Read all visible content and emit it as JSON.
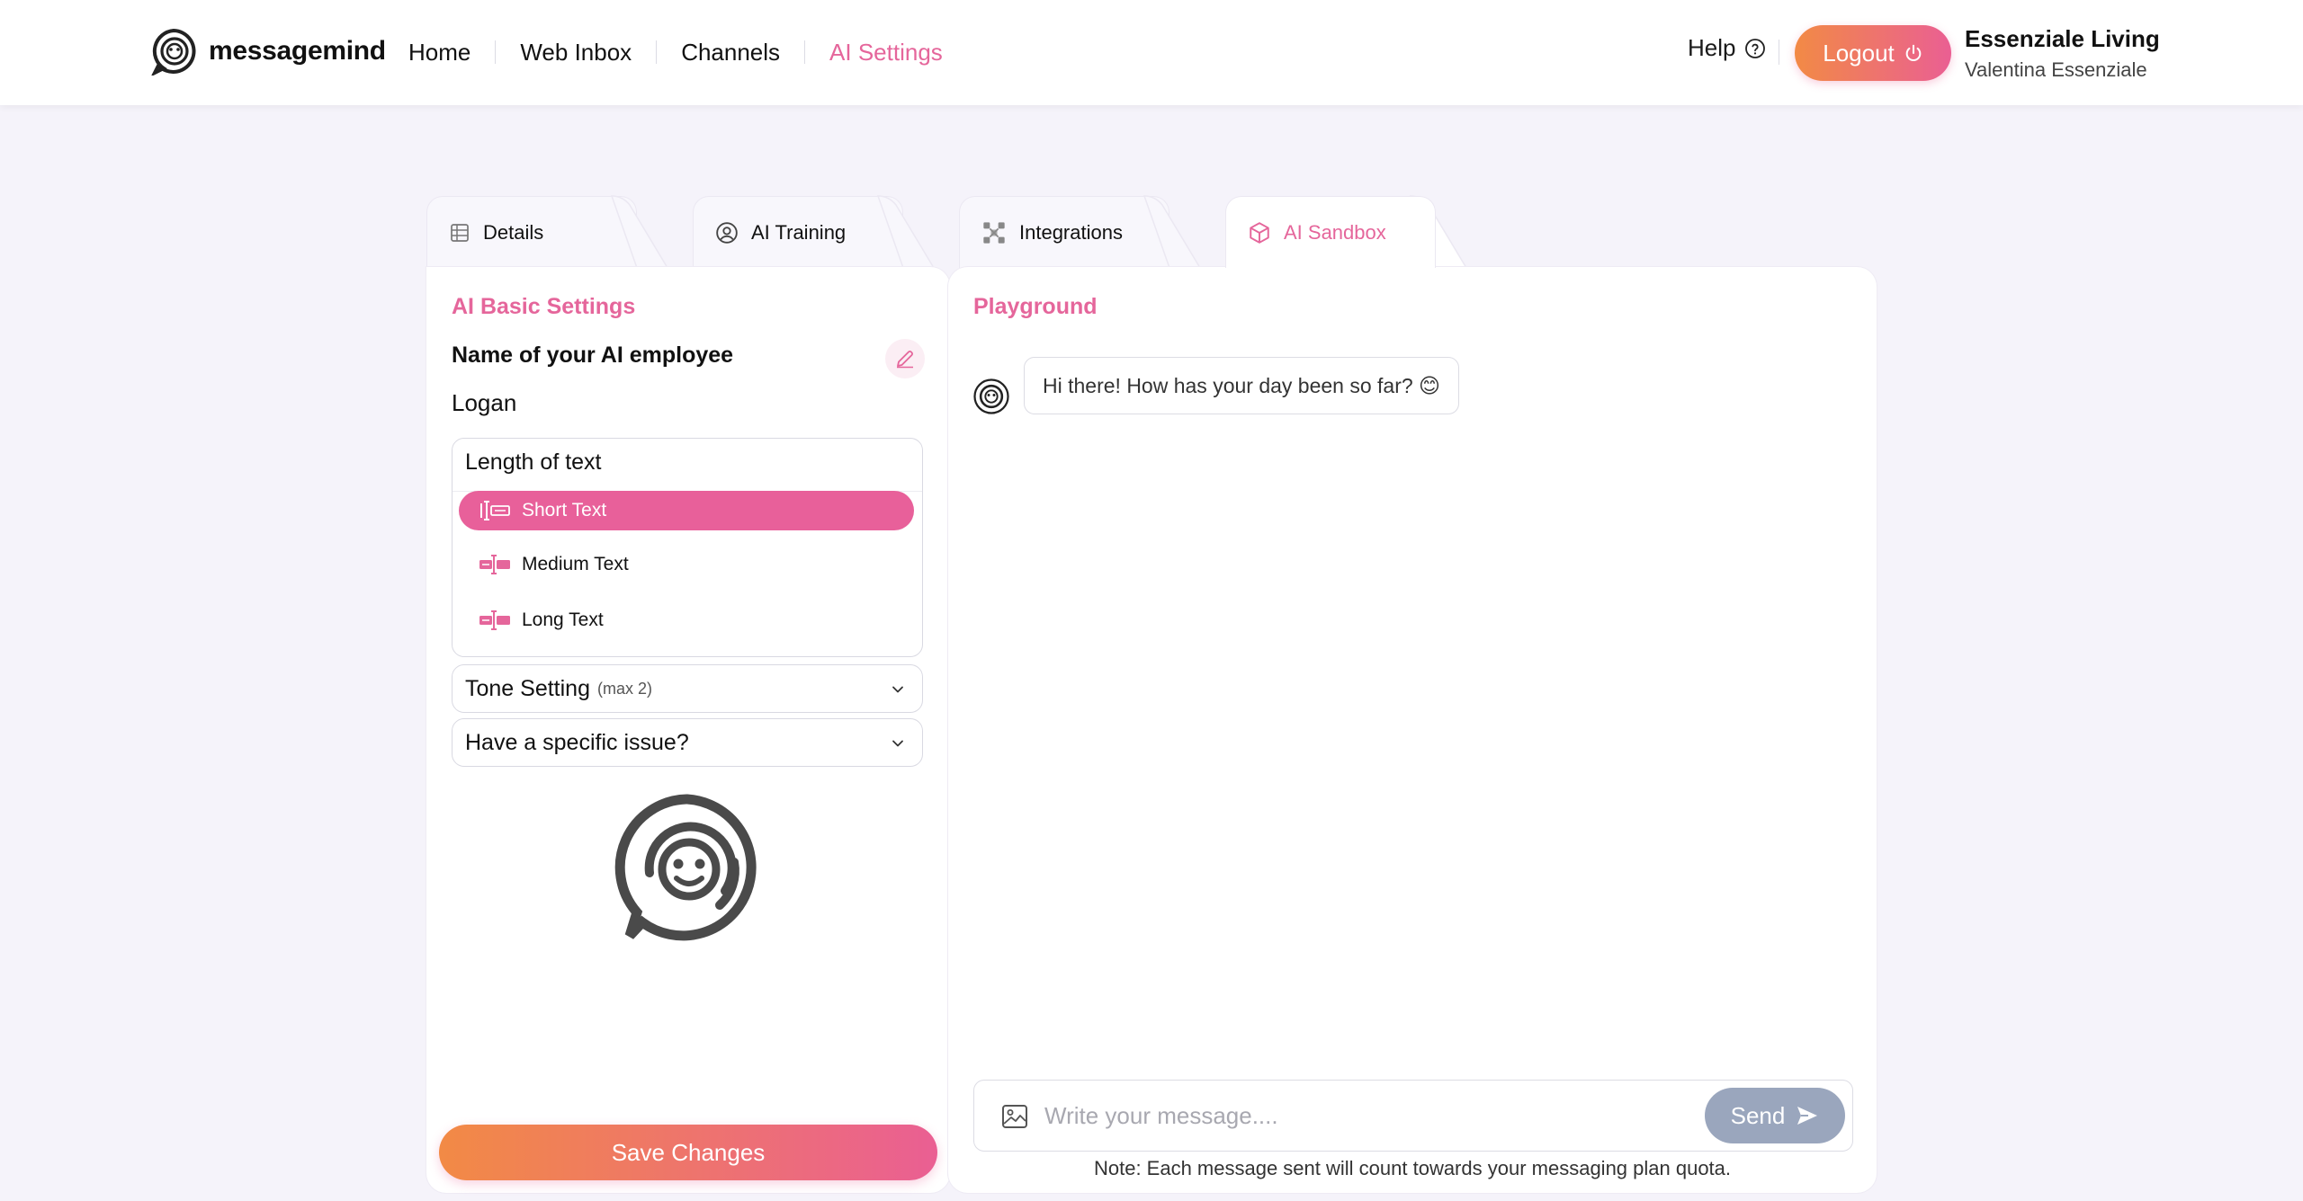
{
  "header": {
    "brand": "messagemind",
    "nav": [
      {
        "label": "Home",
        "active": false
      },
      {
        "label": "Web Inbox",
        "active": false
      },
      {
        "label": "Channels",
        "active": false
      },
      {
        "label": "AI Settings",
        "active": true
      }
    ],
    "help_label": "Help",
    "logout_label": "Logout",
    "company": "Essenziale Living",
    "user_name": "Valentina Essenziale"
  },
  "tabs": [
    {
      "label": "Details",
      "icon": "table-icon",
      "active": false
    },
    {
      "label": "AI Training",
      "icon": "user-circle-icon",
      "active": false
    },
    {
      "label": "Integrations",
      "icon": "integrations-icon",
      "active": false
    },
    {
      "label": "AI Sandbox",
      "icon": "cube-icon",
      "active": true
    }
  ],
  "settings": {
    "title": "AI Basic Settings",
    "employee_label": "Name of your AI employee",
    "employee_name": "Logan",
    "length_title": "Length of text",
    "length_options": [
      {
        "label": "Short Text",
        "selected": true
      },
      {
        "label": "Medium Text",
        "selected": false
      },
      {
        "label": "Long Text",
        "selected": false
      }
    ],
    "tone_label": "Tone Setting",
    "tone_hint": "(max 2)",
    "issue_label": "Have a specific issue?",
    "save_label": "Save Changes"
  },
  "playground": {
    "title": "Playground",
    "messages": [
      {
        "from": "bot",
        "text": "Hi there! How has your day been so far? 😊"
      }
    ],
    "input_placeholder": "Write your message....",
    "send_label": "Send",
    "note": "Note: Each message sent will count towards your messaging plan quota."
  },
  "colors": {
    "accent": "#e5669b",
    "gradient_start": "#f28a45",
    "gradient_end": "#ea5f93",
    "send_button": "#9aa6bd",
    "background": "#f5f3fa"
  }
}
